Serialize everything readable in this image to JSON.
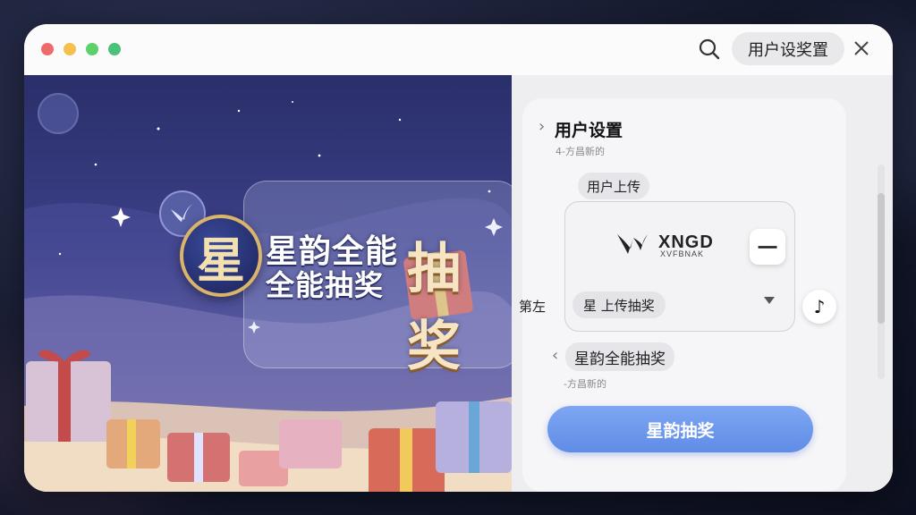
{
  "window": {
    "traffic_lights": [
      "#ef6b6b",
      "#f5c04e",
      "#5fcf6a",
      "#4ac27a"
    ]
  },
  "header": {
    "settings_label": "用户设奖置",
    "icons": {
      "search": "search-icon",
      "close": "close-icon"
    }
  },
  "hero": {
    "badge_char": "星",
    "line1": "星韵全能",
    "line2": "全能抽奖",
    "big_text": "抽奖"
  },
  "panel": {
    "section1_title": "用户设置",
    "section1_sub": "4-方昌新的",
    "upload_chip": "用户上传",
    "brand_name": "XNGD",
    "brand_sub": "XVFBNAK",
    "minus_label": "一",
    "side_label": "第左",
    "select_value": "星 上传抽奖",
    "music_icon": "♪",
    "section2_title": "星韵全能抽奖",
    "section2_sub": "-方昌新的",
    "primary_button": "星韵抽奖"
  }
}
